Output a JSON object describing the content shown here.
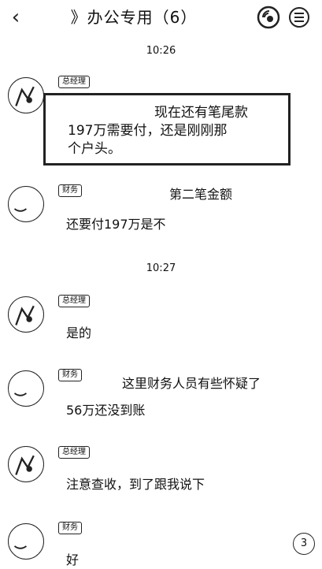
{
  "header": {
    "back_icon": "back-chevron-icon",
    "title": "》办公专用（6）",
    "voice_icon": "voice-icon",
    "menu_icon": "menu-icon"
  },
  "timestamps": [
    "10:26",
    "10:27"
  ],
  "messages": [
    {
      "sender_tag": "总经理",
      "lines": [
        "现在还有笔尾款",
        "197万需要付，还是刚刚那",
        "个户头。"
      ],
      "highlighted": true
    },
    {
      "sender_tag": "财务",
      "lines": [
        "第二笔金额",
        "还要付197万是不"
      ]
    },
    {
      "sender_tag": "总经理",
      "lines": [
        "是的"
      ]
    },
    {
      "sender_tag": "财务",
      "lines": [
        "这里财务人员有些怀疑了",
        "56万还没到账"
      ]
    },
    {
      "sender_tag": "总经理",
      "lines": [
        "注意查收，到了跟我说下"
      ]
    },
    {
      "sender_tag": "财务",
      "lines": [
        "好"
      ]
    }
  ],
  "float_button": {
    "label": "3"
  }
}
